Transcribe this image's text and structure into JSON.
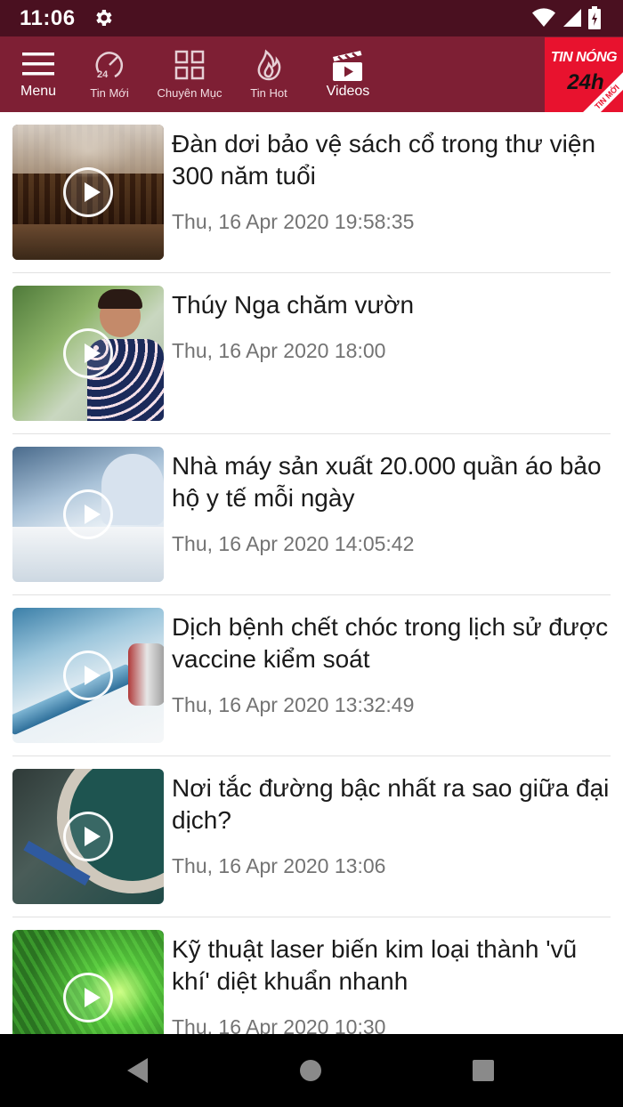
{
  "status_bar": {
    "time": "11:06"
  },
  "nav": {
    "menu_label": "Menu",
    "tabs": [
      {
        "label": "Tin Mới"
      },
      {
        "label": "Chuyên Mục"
      },
      {
        "label": "Tin Hot"
      },
      {
        "label": "Videos"
      }
    ],
    "hot_badge": {
      "top": "TIN NÓNG",
      "middle": "24h",
      "ribbon": "TIN MỚI"
    }
  },
  "articles": [
    {
      "title": "Đàn dơi bảo vệ sách cổ trong thư viện 300 năm tuổi",
      "date": "Thu, 16 Apr 2020 19:58:35"
    },
    {
      "title": "Thúy Nga chăm vườn",
      "date": "Thu, 16 Apr 2020 18:00"
    },
    {
      "title": "Nhà máy sản xuất 20.000 quần áo bảo hộ y tế mỗi ngày",
      "date": "Thu, 16 Apr 2020 14:05:42"
    },
    {
      "title": "Dịch bệnh chết chóc trong lịch sử được vaccine kiểm soát",
      "date": "Thu, 16 Apr 2020 13:32:49"
    },
    {
      "title": "Nơi tắc đường bậc nhất ra sao giữa đại dịch?",
      "date": "Thu, 16 Apr 2020 13:06"
    },
    {
      "title": "Kỹ thuật laser biến kim loại thành 'vũ khí' diệt khuẩn nhanh",
      "date": "Thu, 16 Apr 2020 10:30"
    }
  ],
  "colors": {
    "nav_bg": "#7e1f34",
    "status_bg": "#4a1020",
    "hot_badge": "#e8122e"
  }
}
